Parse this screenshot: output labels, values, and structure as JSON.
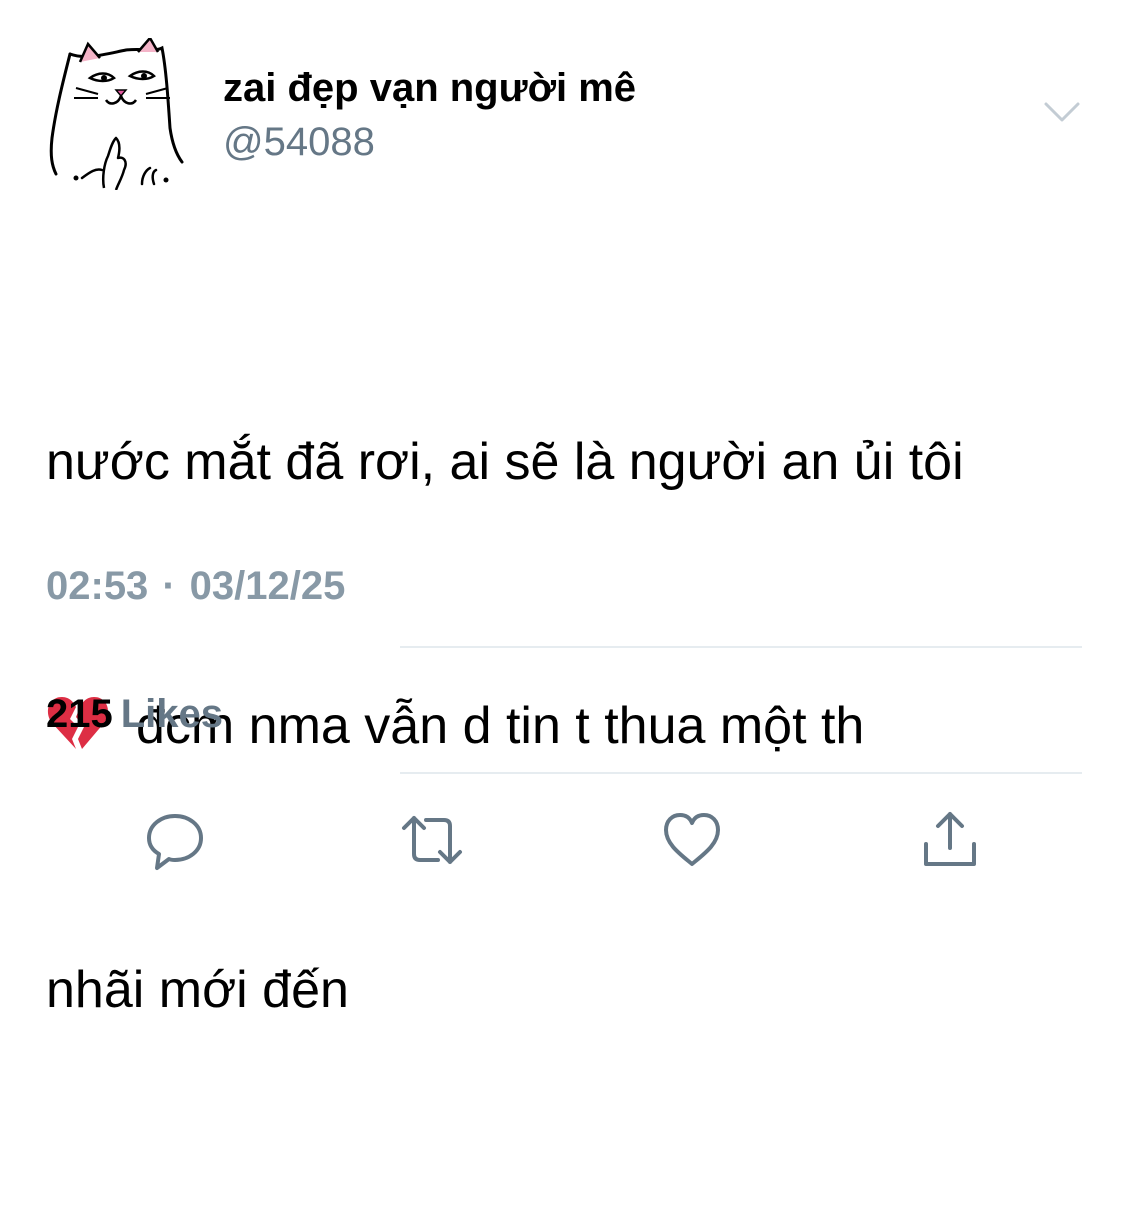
{
  "user": {
    "display_name": "zai đẹp vạn người mê",
    "handle": "@54088",
    "avatar": "cat-middle-finger-avatar"
  },
  "tweet": {
    "lines": [
      "nước mắt đã rơi, ai sẽ là người an ủi tôi",
      "đcm nma vẫn d tin t thua một th",
      "nhãi mới đến"
    ],
    "emoji": "broken-heart-emoji",
    "time": "02:53",
    "separator": "·",
    "date": "03/12/25"
  },
  "stats": {
    "likes_count": "215",
    "likes_label": "Likes"
  },
  "actions": {
    "reply": "reply-icon",
    "retweet": "retweet-icon",
    "like": "heart-icon",
    "share": "share-icon"
  },
  "colors": {
    "secondary_text": "#657786",
    "timestamp": "#8899a6",
    "divider": "#e6ecf0",
    "icon": "#657786",
    "emoji_red": "#dd2e44"
  }
}
